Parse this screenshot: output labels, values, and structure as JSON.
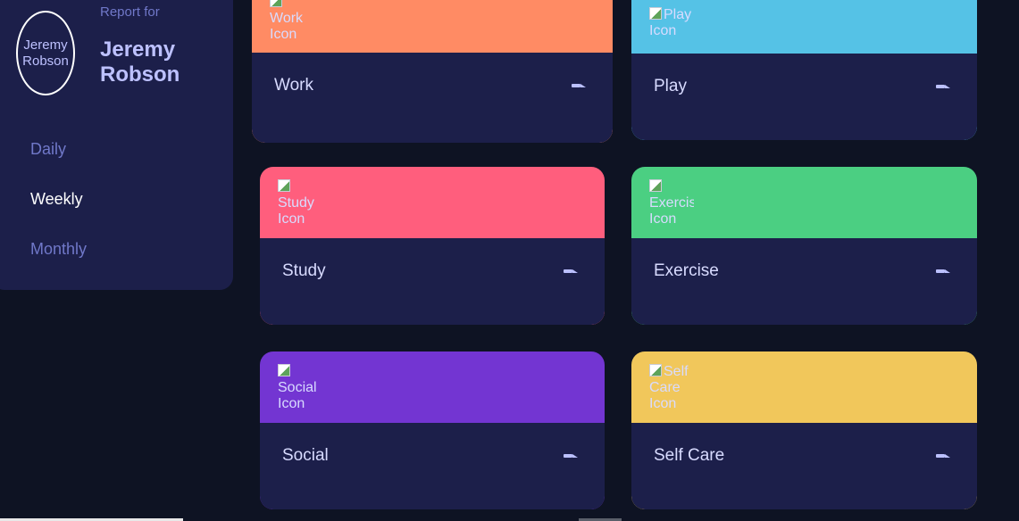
{
  "profile": {
    "avatar_alt": "Jeremy Robson",
    "report_for": "Report for",
    "name": "Jeremy Robson"
  },
  "nav": {
    "items": [
      {
        "label": "Daily",
        "active": false
      },
      {
        "label": "Weekly",
        "active": true
      },
      {
        "label": "Monthly",
        "active": false
      }
    ]
  },
  "cards": [
    {
      "title": "Work",
      "icon_alt": "Work Icon",
      "icon": "ellipsis-icon",
      "accent": "#ff8b64"
    },
    {
      "title": "Play",
      "icon_alt": "Play Icon",
      "icon": "ellipsis-icon",
      "accent": "#55c2e6"
    },
    {
      "title": "Study",
      "icon_alt": "Study Icon",
      "icon": "ellipsis-icon",
      "accent": "#ff5e7d"
    },
    {
      "title": "Exercise",
      "icon_alt": "Exercis Icon",
      "icon": "ellipsis-icon",
      "accent": "#4bcf82"
    },
    {
      "title": "Social",
      "icon_alt": "Social Icon",
      "icon": "ellipsis-icon",
      "accent": "#7335d2"
    },
    {
      "title": "Self Care",
      "icon_alt": "Self Care Icon",
      "icon": "ellipsis-icon",
      "accent": "#f1c75b"
    }
  ],
  "colors": {
    "background": "#0e1323",
    "card_body": "#1c1f4a",
    "muted_text": "#7078c9",
    "text": "#d8dbff"
  }
}
